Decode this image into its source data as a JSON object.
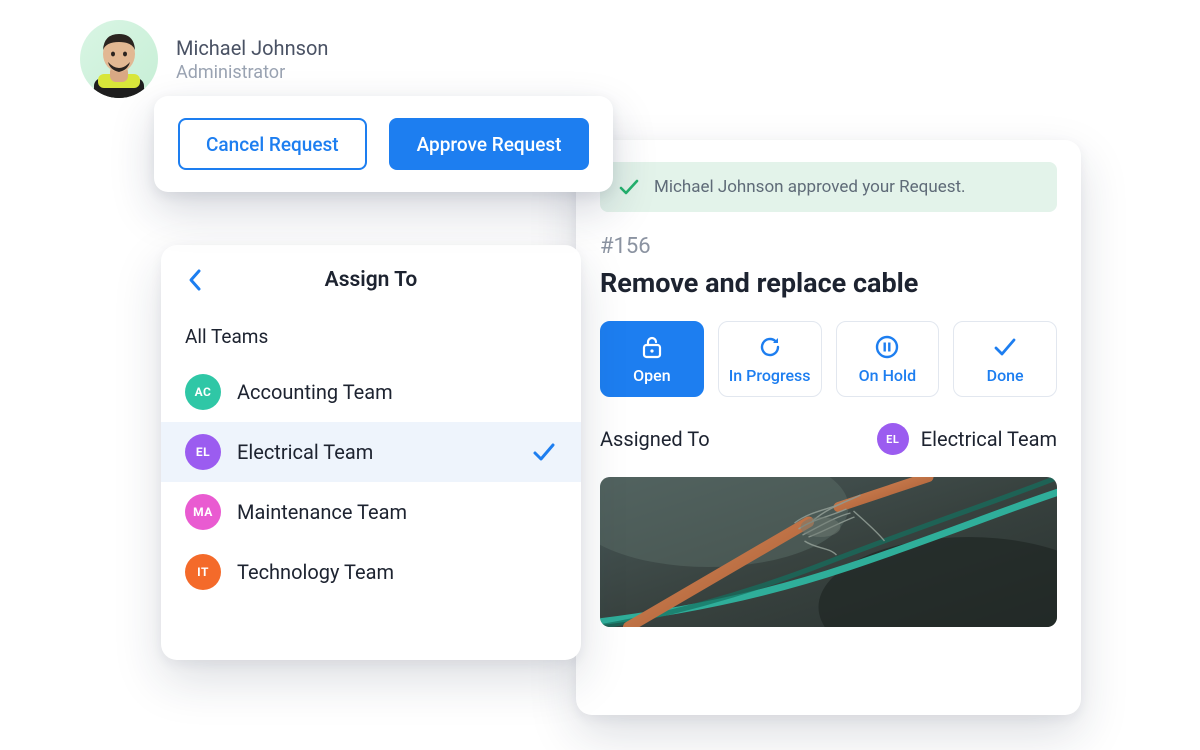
{
  "user": {
    "name": "Michael Johnson",
    "role": "Administrator"
  },
  "actions": {
    "cancel_label": "Cancel Request",
    "approve_label": "Approve Request"
  },
  "assign": {
    "title": "Assign To",
    "section_label": "All Teams",
    "teams": [
      {
        "initials": "AC",
        "name": "Accounting Team",
        "color": "#2fc7a6",
        "selected": false
      },
      {
        "initials": "EL",
        "name": "Electrical Team",
        "color": "#9b5cf0",
        "selected": true
      },
      {
        "initials": "MA",
        "name": "Maintenance Team",
        "color": "#e95bd1",
        "selected": false
      },
      {
        "initials": "IT",
        "name": "Technology Team",
        "color": "#f46a2a",
        "selected": false
      }
    ]
  },
  "detail": {
    "approval_message": "Michael Johnson approved your Request.",
    "id_display": "#156",
    "title": "Remove and replace cable",
    "statuses": [
      {
        "key": "open",
        "label": "Open",
        "active": true
      },
      {
        "key": "inprogress",
        "label": "In Progress",
        "active": false
      },
      {
        "key": "onhold",
        "label": "On Hold",
        "active": false
      },
      {
        "key": "done",
        "label": "Done",
        "active": false
      }
    ],
    "assigned_label": "Assigned To",
    "assigned_team": {
      "initials": "EL",
      "name": "Electrical Team",
      "color": "#9b5cf0"
    }
  }
}
